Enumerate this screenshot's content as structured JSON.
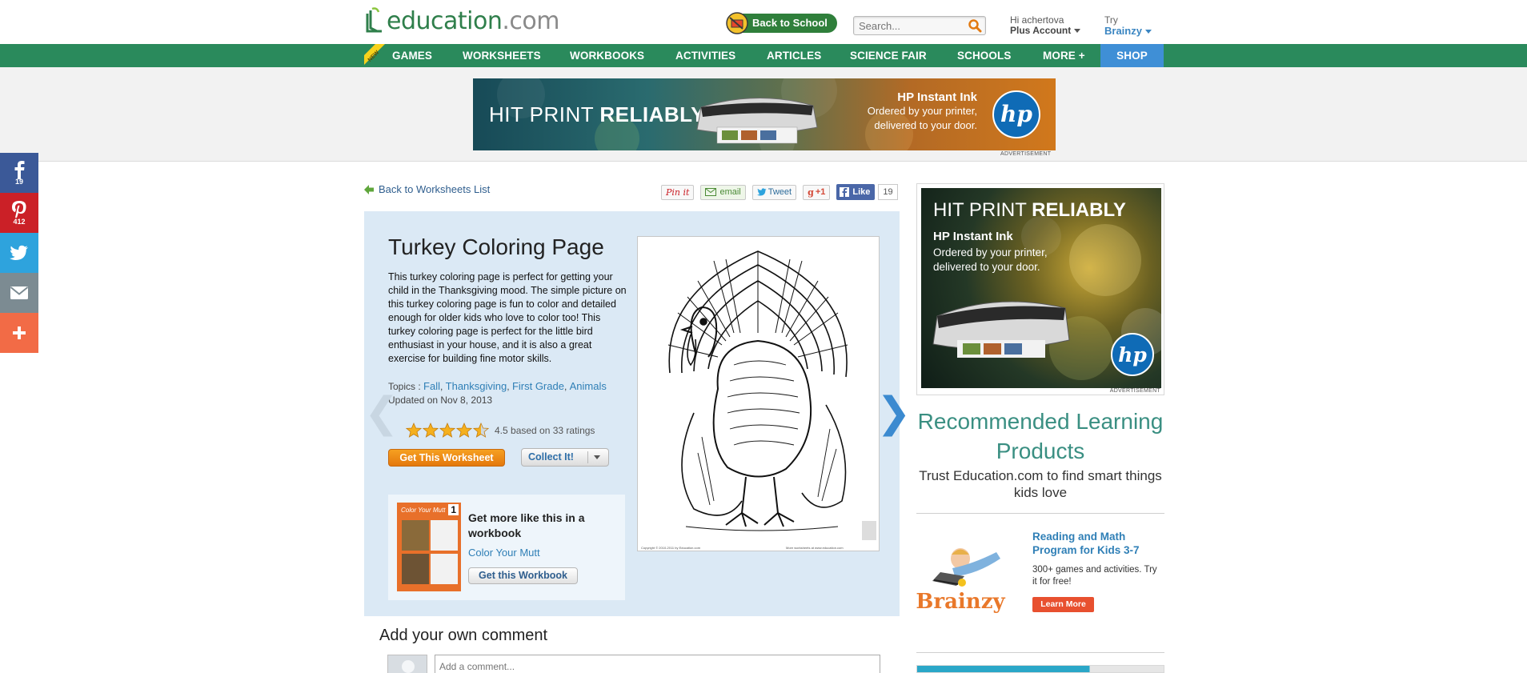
{
  "header": {
    "logo_text": "education",
    "logo_suffix": ".com",
    "back_to_school": "Back to School",
    "search_placeholder": "Search...",
    "greeting": "Hi achertova",
    "account": "Plus Account",
    "try_label": "Try",
    "try_product": "Brainzy"
  },
  "nav": {
    "new_badge": "NEW",
    "items": [
      "GAMES",
      "WORKSHEETS",
      "WORKBOOKS",
      "ACTIVITIES",
      "ARTICLES",
      "SCIENCE FAIR",
      "SCHOOLS",
      "MORE +",
      "SHOP"
    ]
  },
  "ad_banner": {
    "headline_light": "HIT PRINT",
    "headline_bold": "RELIABLY",
    "product": "HP Instant Ink",
    "line1": "Ordered by your printer,",
    "line2": "delivered to your door.",
    "brand": "hp",
    "label": "ADVERTISEMENT"
  },
  "share_bar": {
    "items": [
      {
        "name": "facebook",
        "count": "19",
        "color": "#3b5998"
      },
      {
        "name": "pinterest",
        "count": "412",
        "color": "#cb2027"
      },
      {
        "name": "twitter",
        "count": "",
        "color": "#2ea3dd"
      },
      {
        "name": "email",
        "count": "",
        "color": "#7c8b92"
      },
      {
        "name": "more",
        "count": "",
        "color": "#f26b46"
      }
    ]
  },
  "worksheet": {
    "back_link": "Back to Worksheets List",
    "social": {
      "pin": "Pin it",
      "email": "email",
      "tweet": "Tweet",
      "gplus": "+1",
      "like": "Like",
      "like_count": "19"
    },
    "title": "Turkey Coloring Page",
    "description": "This turkey coloring page is perfect for getting your child in the Thanksgiving mood. The simple picture on this turkey coloring page is fun to color and detailed enough for older kids who love to color too! This turkey coloring page is perfect for the little bird enthusiast in your house, and it is also a great exercise for building fine motor skills.",
    "topics_label": "Topics :",
    "topics": [
      "Fall",
      "Thanksgiving",
      "First Grade",
      "Animals"
    ],
    "updated": "Updated on Nov 8, 2013",
    "rating": 4.5,
    "rating_text": "4.5 based on 33 ratings",
    "get_worksheet": "Get This Worksheet",
    "collect": "Collect It!",
    "image_footer_left": "Copyright © 2010-2011 by Education.com",
    "image_footer_right": "More worksheets at www.education.com"
  },
  "workbook": {
    "prompt": "Get more like this in a workbook",
    "name": "Color Your Mutt",
    "button": "Get this Workbook",
    "cover_title": "Color Your Mutt",
    "cover_grade": "1"
  },
  "comments": {
    "heading": "Add your own comment",
    "placeholder": "Add a comment..."
  },
  "sidebar": {
    "ad": {
      "headline_light": "HIT PRINT",
      "headline_bold": "RELIABLY",
      "product": "HP Instant Ink",
      "line1": "Ordered by your printer,",
      "line2": "delivered to your door.",
      "brand": "hp",
      "label": "ADVERTISEMENT"
    },
    "reco_heading": "Recommended Learning Products",
    "reco_sub": "Trust Education.com to find smart things kids love",
    "product": {
      "logo": "Brainzy",
      "title": "Reading and Math Program for Kids 3-7",
      "desc": "300+ games and activities. Try it for free!",
      "button": "Learn More"
    }
  },
  "colors": {
    "nav_green": "#2a8a5c",
    "shop_blue": "#3f8fd6",
    "link_blue": "#2f7fb6",
    "panel_blue": "#dbe9f5",
    "orange": "#e4780c",
    "teal": "#3a8f82"
  }
}
